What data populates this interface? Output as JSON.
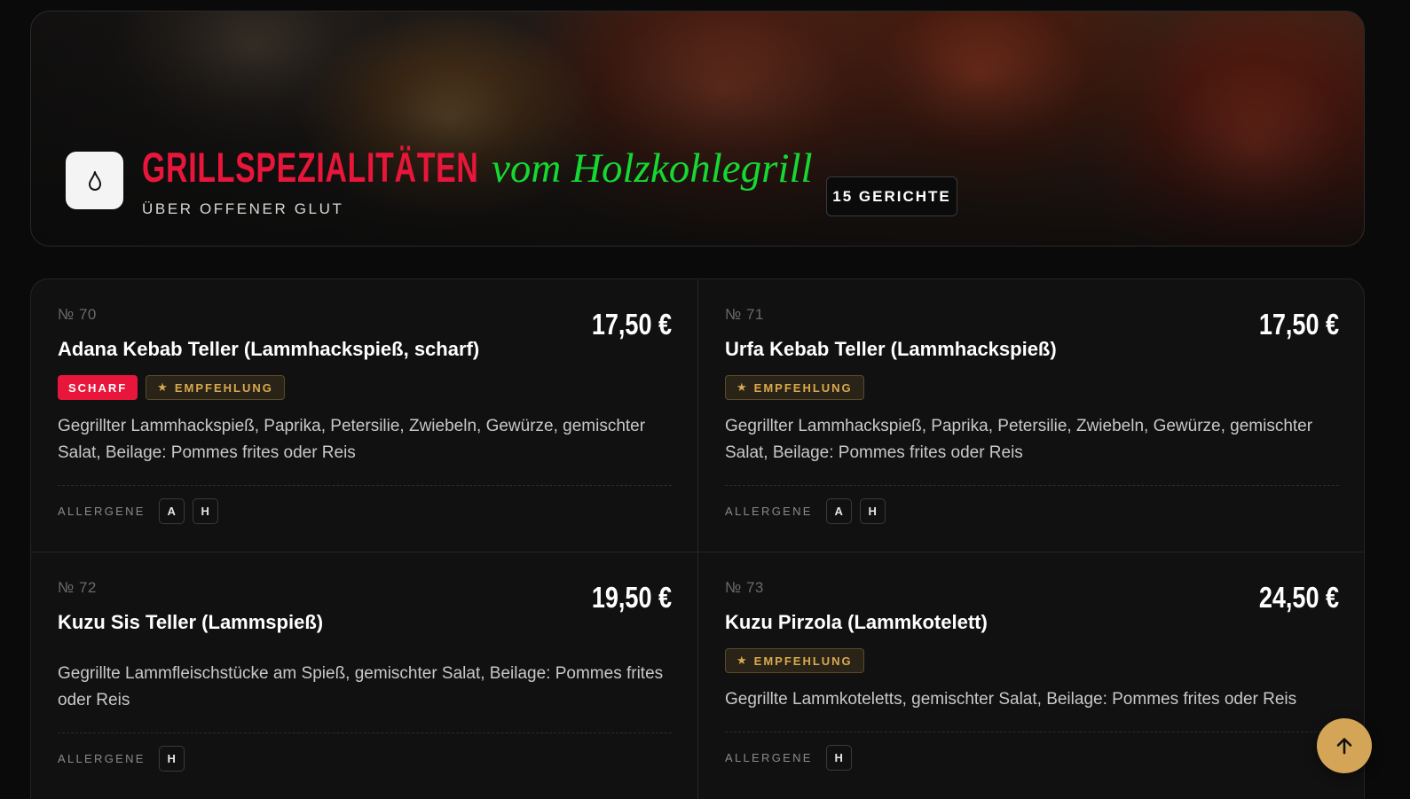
{
  "hero": {
    "title_main": "GRILLSPEZIALITÄTEN",
    "title_script": "vom Holzkohlegrill",
    "subtitle": "ÜBER OFFENER GLUT",
    "count_label": "15 GERICHTE",
    "icon": "flame-icon"
  },
  "colors": {
    "accent_red": "#e8163a",
    "accent_green": "#16d832",
    "accent_gold": "#d4a457",
    "background": "#0a0a0a"
  },
  "allergens_label": "ALLERGENE",
  "dishes": [
    {
      "number": "№ 70",
      "name": "Adana Kebab Teller (Lammhackspieß, scharf)",
      "price": "17,50 €",
      "badge_hot": "SCHARF",
      "badge_recommend": "EMPFEHLUNG",
      "description": "Gegrillter Lammhackspieß, Paprika, Petersilie, Zwiebeln, Gewürze, gemischter Salat, Beilage: Pommes frites oder Reis",
      "allergens": [
        "A",
        "H"
      ]
    },
    {
      "number": "№ 71",
      "name": "Urfa Kebab Teller (Lammhackspieß)",
      "price": "17,50 €",
      "badge_recommend": "EMPFEHLUNG",
      "description": "Gegrillter Lammhackspieß, Paprika, Petersilie, Zwiebeln, Gewürze, gemischter Salat, Beilage: Pommes frites oder Reis",
      "allergens": [
        "A",
        "H"
      ]
    },
    {
      "number": "№ 72",
      "name": "Kuzu Sis Teller (Lammspieß)",
      "price": "19,50 €",
      "description": "Gegrillte Lammfleischstücke am Spieß, gemischter Salat, Beilage: Pommes frites oder Reis",
      "allergens": [
        "H"
      ]
    },
    {
      "number": "№ 73",
      "name": "Kuzu Pirzola (Lammkotelett)",
      "price": "24,50 €",
      "badge_recommend": "EMPFEHLUNG",
      "description": "Gegrillte Lammkoteletts, gemischter Salat, Beilage: Pommes frites oder Reis",
      "allergens": [
        "H"
      ]
    }
  ],
  "scroll_top_icon": "arrow-up-icon"
}
